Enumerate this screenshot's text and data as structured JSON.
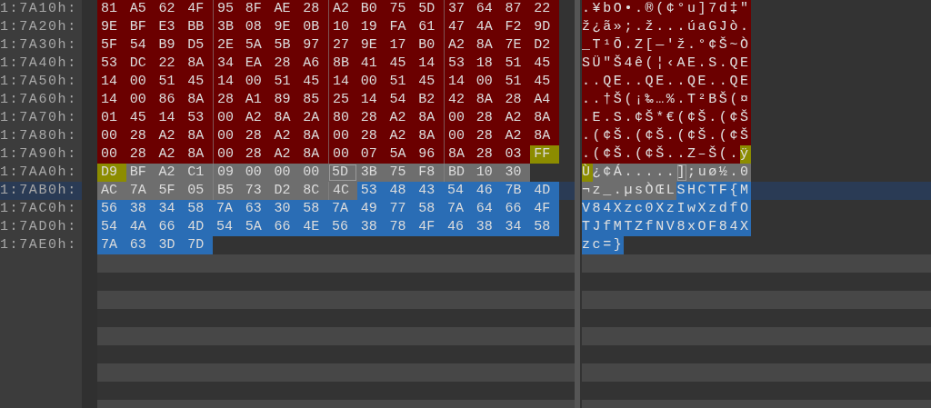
{
  "rows": [
    {
      "offset": "1:7A10h:",
      "current": false,
      "bytes": [
        {
          "kind": "region",
          "hex": [
            "81",
            "A5",
            "62",
            "4F",
            "95",
            "8F",
            "AE",
            "28",
            "A2",
            "B0",
            "75",
            "5D",
            "37",
            "64",
            "87",
            "22"
          ]
        }
      ],
      "ascii": [
        {
          "kind": "region",
          "text": ".¥bO•.®(¢°u]7d‡\""
        }
      ]
    },
    {
      "offset": "1:7A20h:",
      "current": false,
      "bytes": [
        {
          "kind": "region",
          "hex": [
            "9E",
            "BF",
            "E3",
            "BB",
            "3B",
            "08",
            "9E",
            "0B",
            "10",
            "19",
            "FA",
            "61",
            "47",
            "4A",
            "F2",
            "9D"
          ]
        }
      ],
      "ascii": [
        {
          "kind": "region",
          "text": "ž¿ã»;.ž...úaGJò."
        }
      ]
    },
    {
      "offset": "1:7A30h:",
      "current": false,
      "bytes": [
        {
          "kind": "region",
          "hex": [
            "5F",
            "54",
            "B9",
            "D5",
            "2E",
            "5A",
            "5B",
            "97",
            "27",
            "9E",
            "17",
            "B0",
            "A2",
            "8A",
            "7E",
            "D2"
          ]
        }
      ],
      "ascii": [
        {
          "kind": "region",
          "text": "_T¹Õ.Z[—'ž.°¢Š~Ò"
        }
      ]
    },
    {
      "offset": "1:7A40h:",
      "current": false,
      "bytes": [
        {
          "kind": "region",
          "hex": [
            "53",
            "DC",
            "22",
            "8A",
            "34",
            "EA",
            "28",
            "A6",
            "8B",
            "41",
            "45",
            "14",
            "53",
            "18",
            "51",
            "45"
          ]
        }
      ],
      "ascii": [
        {
          "kind": "region",
          "text": "SÜ\"Š4ê(¦‹AE.S.QE"
        }
      ]
    },
    {
      "offset": "1:7A50h:",
      "current": false,
      "bytes": [
        {
          "kind": "region",
          "hex": [
            "14",
            "00",
            "51",
            "45",
            "14",
            "00",
            "51",
            "45",
            "14",
            "00",
            "51",
            "45",
            "14",
            "00",
            "51",
            "45"
          ]
        }
      ],
      "ascii": [
        {
          "kind": "region",
          "text": "..QE..QE..QE..QE"
        }
      ]
    },
    {
      "offset": "1:7A60h:",
      "current": false,
      "bytes": [
        {
          "kind": "region",
          "hex": [
            "14",
            "00",
            "86",
            "8A",
            "28",
            "A1",
            "89",
            "85",
            "25",
            "14",
            "54",
            "B2",
            "42",
            "8A",
            "28",
            "A4"
          ]
        }
      ],
      "ascii": [
        {
          "kind": "region",
          "text": "..†Š(¡‰…%.T²BŠ(¤"
        }
      ]
    },
    {
      "offset": "1:7A70h:",
      "current": false,
      "bytes": [
        {
          "kind": "region",
          "hex": [
            "01",
            "45",
            "14",
            "53",
            "00",
            "A2",
            "8A",
            "2A",
            "80",
            "28",
            "A2",
            "8A",
            "00",
            "28",
            "A2",
            "8A"
          ]
        }
      ],
      "ascii": [
        {
          "kind": "region",
          "text": ".E.S.¢Š*€(¢Š.(¢Š"
        }
      ]
    },
    {
      "offset": "1:7A80h:",
      "current": false,
      "bytes": [
        {
          "kind": "region",
          "hex": [
            "00",
            "28",
            "A2",
            "8A",
            "00",
            "28",
            "A2",
            "8A",
            "00",
            "28",
            "A2",
            "8A",
            "00",
            "28",
            "A2",
            "8A"
          ]
        }
      ],
      "ascii": [
        {
          "kind": "region",
          "text": ".(¢Š.(¢Š.(¢Š.(¢Š"
        }
      ]
    },
    {
      "offset": "1:7A90h:",
      "current": false,
      "bytes": [
        {
          "kind": "region",
          "hex": [
            "00",
            "28",
            "A2",
            "8A",
            "00",
            "28",
            "A2",
            "8A",
            "00",
            "07",
            "5A",
            "96",
            "8A",
            "28",
            "03"
          ]
        },
        {
          "kind": "mark",
          "hex": [
            "FF"
          ]
        }
      ],
      "ascii": [
        {
          "kind": "region",
          "text": ".(¢Š.(¢Š..Z–Š(."
        },
        {
          "kind": "mark",
          "text": "ÿ"
        }
      ]
    },
    {
      "offset": "1:7AA0h:",
      "current": false,
      "bytes": [
        {
          "kind": "mark",
          "hex": [
            "D9"
          ]
        },
        {
          "kind": "block",
          "hex": [
            "BF",
            "A2",
            "C1",
            "09",
            "00",
            "00",
            "00"
          ]
        },
        {
          "kind": "cursor",
          "hex": [
            "5D"
          ]
        },
        {
          "kind": "block",
          "hex": [
            "3B",
            "75",
            "F8",
            "BD",
            "10",
            "30"
          ]
        }
      ],
      "ascii": [
        {
          "kind": "mark",
          "text": "Ù"
        },
        {
          "kind": "block",
          "text": "¿¢Á....."
        },
        {
          "kind": "cursor",
          "text": "]"
        },
        {
          "kind": "block",
          "text": ";uø½.0"
        }
      ]
    },
    {
      "offset": "1:7AB0h:",
      "current": true,
      "bytes": [
        {
          "kind": "block",
          "hex": [
            "AC",
            "7A",
            "5F",
            "05",
            "B5",
            "73",
            "D2",
            "8C",
            "4C"
          ]
        },
        {
          "kind": "selection",
          "hex": [
            "53",
            "48",
            "43",
            "54",
            "46",
            "7B",
            "4D"
          ]
        }
      ],
      "ascii": [
        {
          "kind": "block",
          "text": "¬z_.µsÒŒL"
        },
        {
          "kind": "selection",
          "text": "SHCTF{M"
        }
      ]
    },
    {
      "offset": "1:7AC0h:",
      "current": false,
      "bytes": [
        {
          "kind": "selection",
          "hex": [
            "56",
            "38",
            "34",
            "58",
            "7A",
            "63",
            "30",
            "58",
            "7A",
            "49",
            "77",
            "58",
            "7A",
            "64",
            "66",
            "4F"
          ]
        }
      ],
      "ascii": [
        {
          "kind": "selection",
          "text": "V84Xzc0XzIwXzdfO"
        }
      ]
    },
    {
      "offset": "1:7AD0h:",
      "current": false,
      "bytes": [
        {
          "kind": "selection",
          "hex": [
            "54",
            "4A",
            "66",
            "4D",
            "54",
            "5A",
            "66",
            "4E",
            "56",
            "38",
            "78",
            "4F",
            "46",
            "38",
            "34",
            "58"
          ]
        }
      ],
      "ascii": [
        {
          "kind": "selection",
          "text": "TJfMTZfNV8xOF84X"
        }
      ]
    },
    {
      "offset": "1:7AE0h:",
      "current": false,
      "bytes": [
        {
          "kind": "selection",
          "hex": [
            "7A",
            "63",
            "3D",
            "7D"
          ]
        }
      ],
      "ascii": [
        {
          "kind": "selection",
          "text": "zc=}"
        }
      ]
    }
  ]
}
